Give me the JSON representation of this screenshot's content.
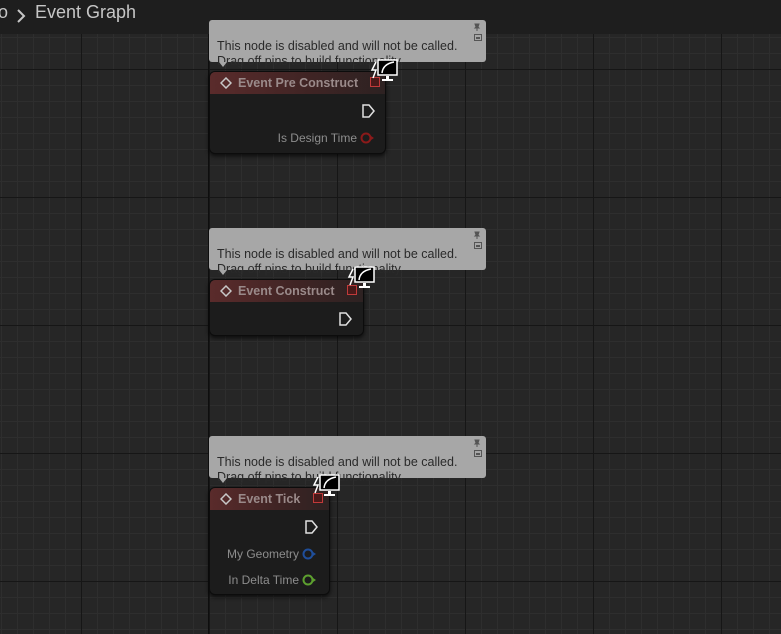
{
  "breadcrumb": {
    "previous": "o",
    "current": "Event Graph"
  },
  "comments": [
    {
      "text": "This node is disabled and will not be called.\nDrag off pins to build functionality."
    },
    {
      "text": "This node is disabled and will not be called.\nDrag off pins to build functionality."
    },
    {
      "text": "This node is disabled and will not be called.\nDrag off pins to build functionality."
    }
  ],
  "nodes": [
    {
      "title": "Event Pre Construct",
      "pins": [
        {
          "label": "Is Design Time",
          "type": "bool",
          "color": "#8b1a1a"
        }
      ]
    },
    {
      "title": "Event Construct",
      "pins": []
    },
    {
      "title": "Event Tick",
      "pins": [
        {
          "label": "My Geometry",
          "type": "struct",
          "color": "#1f4e9a"
        },
        {
          "label": "In Delta Time",
          "type": "float",
          "color": "#5da02f"
        }
      ]
    }
  ],
  "icons": {
    "node_icon": "event-diamond-icon",
    "exec": "exec-pin-icon",
    "client": "client-only-icon",
    "comment_pin": "comment-pin-icon"
  },
  "colors": {
    "background": "#262626",
    "node_header": "#5a2b2b",
    "comment": "#a7a7a7",
    "bool_pin": "#8b1a1a",
    "struct_pin": "#1f4e9a",
    "float_pin": "#5da02f"
  }
}
